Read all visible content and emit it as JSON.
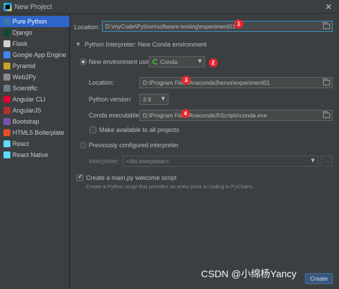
{
  "window": {
    "title": "New Project",
    "close_glyph": "✕"
  },
  "sidebar": {
    "items": [
      {
        "label": "Pure Python",
        "icon": "python-icon",
        "color": "#3b77a8",
        "selected": true
      },
      {
        "label": "Django",
        "icon": "django-icon",
        "color": "#0c4b33"
      },
      {
        "label": "Flask",
        "icon": "flask-icon",
        "color": "#d0d0d0"
      },
      {
        "label": "Google App Engine",
        "icon": "app-engine-icon",
        "color": "#4285f4"
      },
      {
        "label": "Pyramid",
        "icon": "pyramid-icon",
        "color": "#c9a12b"
      },
      {
        "label": "Web2Py",
        "icon": "web2py-icon",
        "color": "#8a8a8a"
      },
      {
        "label": "Scientific",
        "icon": "scientific-icon",
        "color": "#6c7c8c"
      },
      {
        "label": "Angular CLI",
        "icon": "angular-cli-icon",
        "color": "#dd0031"
      },
      {
        "label": "AngularJS",
        "icon": "angularjs-icon",
        "color": "#b52e31"
      },
      {
        "label": "Bootstrap",
        "icon": "bootstrap-icon",
        "color": "#7952b3"
      },
      {
        "label": "HTML5 Boilerplate",
        "icon": "html5-icon",
        "color": "#e34f26"
      },
      {
        "label": "React",
        "icon": "react-icon",
        "color": "#61dafb"
      },
      {
        "label": "React Native",
        "icon": "react-native-icon",
        "color": "#61dafb"
      }
    ]
  },
  "main": {
    "location_label": "Location:",
    "location_value": "D:\\myCode\\Python\\software-testing\\experiment01",
    "interpreter_section": "Python Interpreter: New Conda environment",
    "new_env_label": "New environment using",
    "new_env_tool": "Conda",
    "env_location_label": "Location:",
    "env_location_value": "D:\\Program Files\\Anaconda3\\envs\\experiment01",
    "python_version_label": "Python version:",
    "python_version_value": "3.9",
    "conda_exec_label": "Conda executable:",
    "conda_exec_value": "D:\\Program Files\\Anaconda3\\Scripts\\conda.exe",
    "make_available_label": "Make available to all projects",
    "previous_interp_label": "Previously configured interpreter",
    "interpreter_label": "Interpreter:",
    "interpreter_value": "<No interpreter>",
    "ellipsis": "...",
    "create_main_label": "Create a main.py welcome script",
    "create_main_hint": "Create a Python script that provides an entry point to coding in PyCharm.",
    "create_button": "Create"
  },
  "badges": [
    "1",
    "2",
    "3",
    "4"
  ],
  "watermark": "CSDN @小绵杨Yancy"
}
